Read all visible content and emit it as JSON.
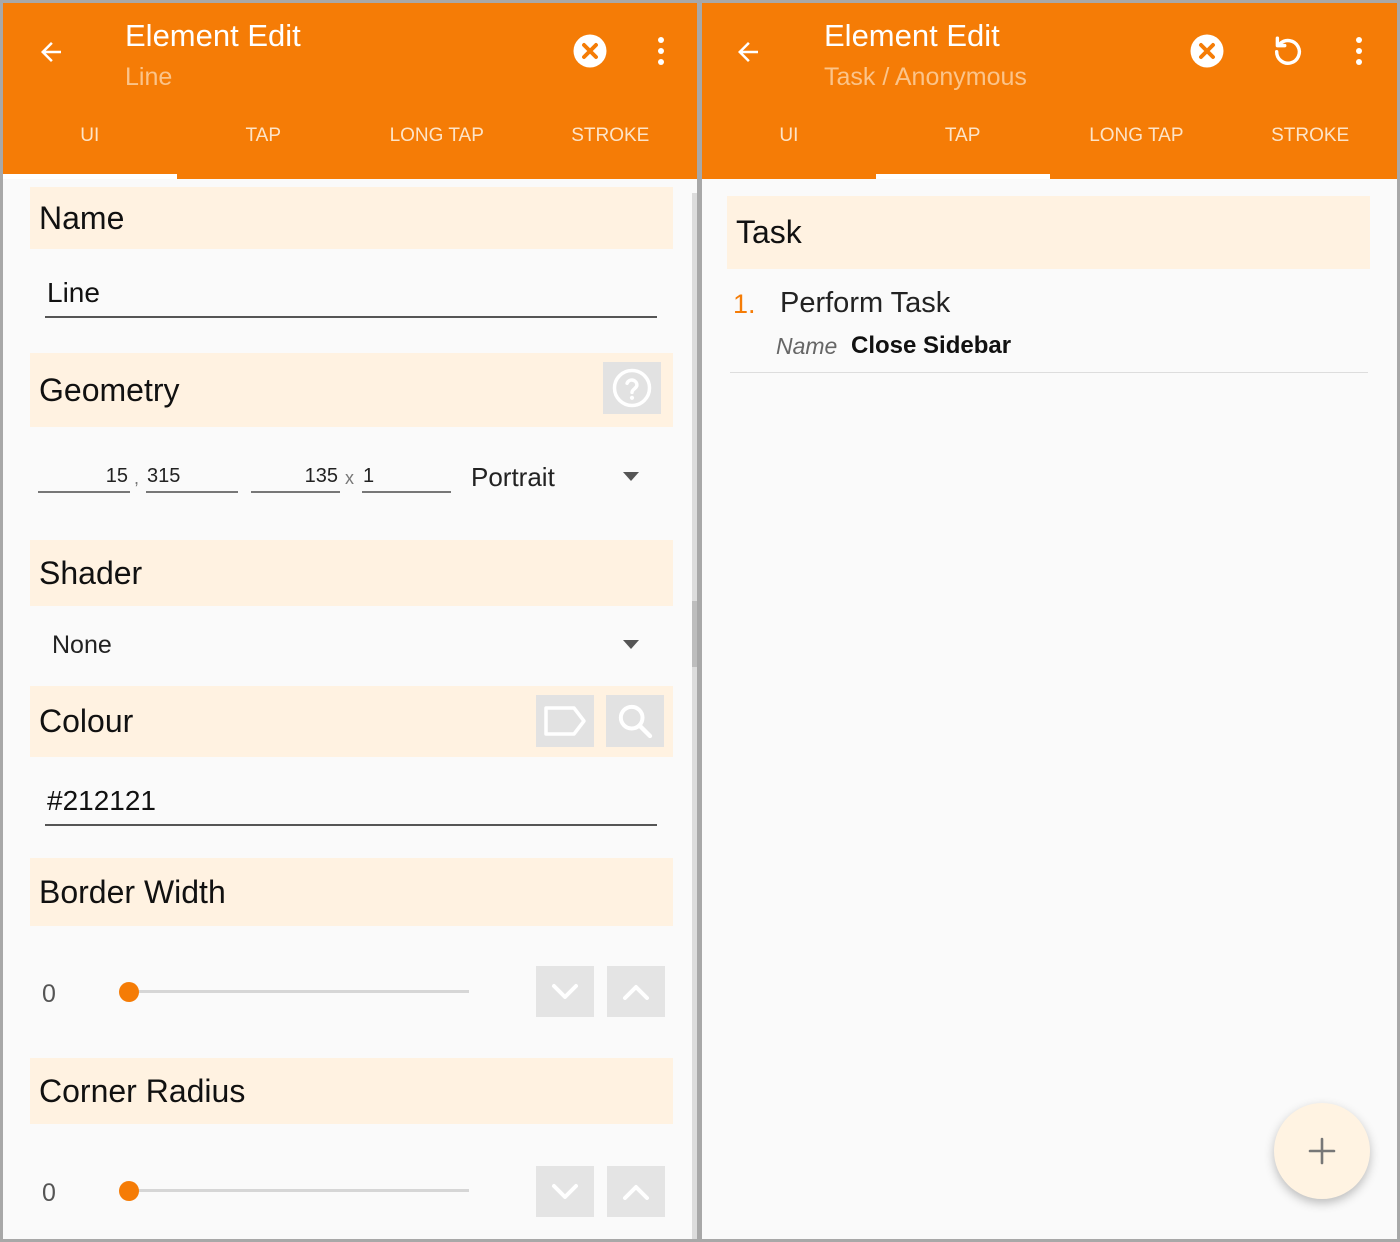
{
  "left_panel": {
    "header": {
      "title": "Element Edit",
      "subtitle": "Line"
    },
    "tabs": [
      {
        "label": "UI",
        "active": true
      },
      {
        "label": "TAP",
        "active": false
      },
      {
        "label": "LONG TAP",
        "active": false
      },
      {
        "label": "STROKE",
        "active": false
      }
    ],
    "name_section": {
      "header": "Name",
      "value": "Line"
    },
    "geometry_section": {
      "header": "Geometry",
      "x": "15",
      "separator_pos": ",",
      "y": "315",
      "width": "135",
      "separator_size": "x",
      "height": "1",
      "orientation": "Portrait"
    },
    "shader_section": {
      "header": "Shader",
      "value": "None"
    },
    "colour_section": {
      "header": "Colour",
      "value": "#212121"
    },
    "border_width_section": {
      "header": "Border Width",
      "value": "0",
      "slider_fraction": 0
    },
    "corner_radius_section": {
      "header": "Corner Radius",
      "value": "0",
      "slider_fraction": 0
    }
  },
  "right_panel": {
    "header": {
      "title": "Element Edit",
      "subtitle": "Task / Anonymous"
    },
    "tabs": [
      {
        "label": "UI",
        "active": false
      },
      {
        "label": "TAP",
        "active": true
      },
      {
        "label": "LONG TAP",
        "active": false
      },
      {
        "label": "STROKE",
        "active": false
      }
    ],
    "task_section": {
      "header": "Task",
      "items": [
        {
          "number": "1.",
          "action": "Perform Task",
          "param_label": "Name",
          "param_value": "Close Sidebar"
        }
      ]
    }
  },
  "icons": {
    "back": "arrow-left-icon",
    "cancel": "close-circle-icon",
    "undo": "undo-icon",
    "overflow": "more-vert-icon",
    "help": "help-circle-icon",
    "tag": "label-icon",
    "search": "search-icon",
    "step_down": "chevron-down-icon",
    "step_up": "chevron-up-icon",
    "add": "plus-icon"
  },
  "colors": {
    "accent": "#f57c06",
    "section_bg": "#fff2e1",
    "number_color": "#f57c06"
  }
}
